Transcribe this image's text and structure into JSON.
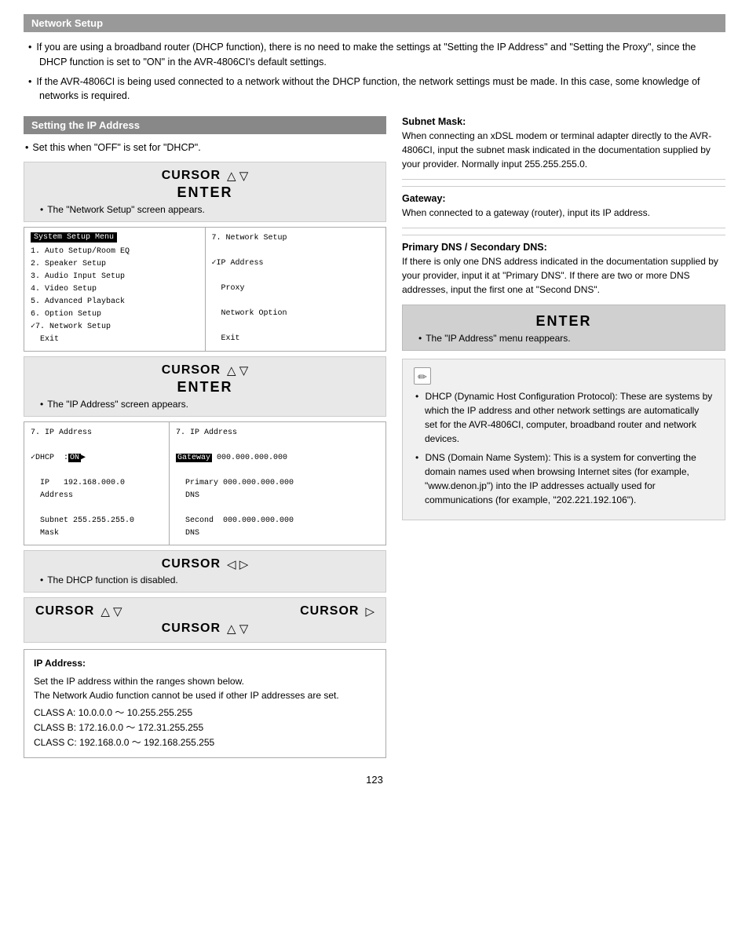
{
  "page": {
    "number": "123"
  },
  "network_setup": {
    "header": "Network Setup",
    "bullet1": "If you are using a broadband router (DHCP function), there is no need to make the settings at \"Setting the IP Address\" and \"Setting the Proxy\", since the DHCP function is set to \"ON\" in the AVR-4806CI's default settings.",
    "bullet2": "If the AVR-4806CI is being used connected to a network without the DHCP function, the network settings must be made. In this case, some knowledge of networks is required."
  },
  "left_col": {
    "sub_header": "Setting the IP Address",
    "bullet_intro": "Set this when \"OFF\" is set for \"DHCP\".",
    "block1": {
      "cursor_label": "CURSOR",
      "cursor_arrows": "△  ▽",
      "enter_label": "ENTER",
      "sub_bullet": "The \"Network Setup\" screen appears."
    },
    "screen1": {
      "left_title": "System Setup Menu",
      "left_lines": [
        "1. Auto Setup/Room EQ",
        "2. Speaker Setup",
        "3. Audio Input Setup",
        "4. Video Setup",
        "5. Advanced Playback",
        "6. Option Setup",
        "✓7. Network Setup",
        "  Exit"
      ],
      "right_lines": [
        "7. Network Setup",
        "",
        "✓IP Address",
        "",
        "  Proxy",
        "",
        "  Network Option",
        "",
        "  Exit"
      ]
    },
    "block2": {
      "cursor_label": "CURSOR",
      "cursor_arrows": "△  ▽",
      "enter_label": "ENTER",
      "sub_bullet": "The \"IP Address\" screen appears."
    },
    "screen2": {
      "left_lines": [
        "7. IP Address",
        "",
        "✓DHCP   :[ON]▶",
        "",
        "  IP     192.168.000.0",
        "  Address",
        "",
        "  Subnet  255.255.255.0",
        "  Mask"
      ],
      "right_lines": [
        "7. IP Address",
        "",
        "[Gateway] 000.000.000.000",
        "",
        "  Primary 000.000.000.000",
        "  DNS",
        "",
        "  Second  000.000.000.000",
        "  DNS"
      ]
    },
    "block3": {
      "cursor_label": "CURSOR",
      "cursor_arrows": "◁  ▷",
      "sub_bullet": "The DHCP function is disabled."
    },
    "block4": {
      "cursor_label1": "CURSOR",
      "cursor_arrows1": "△  ▽",
      "cursor_label2": "CURSOR",
      "cursor_arrows2": "▷",
      "cursor_label3": "CURSOR",
      "cursor_arrows3": "△  ▽"
    },
    "ip_box": {
      "title": "IP Address:",
      "line1": "Set the IP address within the ranges shown below.",
      "line2": "The Network Audio function cannot be used if other IP addresses are set.",
      "classA": "CLASS A: 10.0.0.0 ～ 10.255.255.255",
      "classB": "CLASS B: 172.16.0.0 ～ 172.31.255.255",
      "classC": "CLASS C: 192.168.0.0 ～ 192.168.255.255"
    }
  },
  "right_col": {
    "subnet_title": "Subnet Mask:",
    "subnet_text": "When connecting an xDSL modem or terminal adapter directly to the AVR-4806CI, input the subnet mask indicated in the documentation supplied by your provider. Normally input 255.255.255.0.",
    "gateway_title": "Gateway:",
    "gateway_text": "When connected to a gateway (router), input its IP address.",
    "dns_title": "Primary DNS / Secondary DNS:",
    "dns_text": "If there is only one DNS address indicated in the documentation supplied by your provider, input it at \"Primary DNS\". If there are two or more DNS addresses, input the first one at \"Second DNS\".",
    "enter_block": {
      "enter_label": "ENTER",
      "sub_bullet": "The \"IP Address\" menu reappears."
    },
    "note_icon": "✏",
    "notes": [
      "DHCP (Dynamic Host Configuration Protocol): These are systems by which the IP address and other network settings are automatically set for the AVR-4806CI, computer, broadband router and network devices.",
      "DNS (Domain Name System): This is a system for converting the domain names used when browsing Internet sites (for example, \"www.denon.jp\") into the IP addresses actually used for communications (for example, \"202.221.192.106\")."
    ]
  }
}
